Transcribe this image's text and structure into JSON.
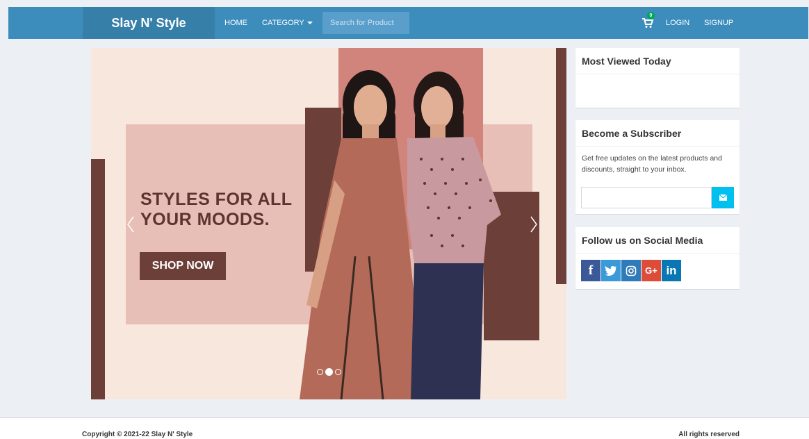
{
  "navbar": {
    "brand": "Slay N' Style",
    "home": "HOME",
    "category": "CATEGORY",
    "search_placeholder": "Search for Product",
    "cart_count": "0",
    "login": "LOGIN",
    "signup": "SIGNUP",
    "bg_color": "#3c8dbc"
  },
  "carousel": {
    "headline_line1": "STYLES FOR ALL",
    "headline_line2": "YOUR MOODS.",
    "cta": "SHOP NOW",
    "slide_count": 3,
    "active_slide": 2
  },
  "sidebar": {
    "most_viewed_title": "Most Viewed Today",
    "subscriber_title": "Become a Subscriber",
    "subscriber_text": "Get free updates on the latest products and discounts, straight to your inbox.",
    "subscribe_icon": "envelope-icon",
    "social_title": "Follow us on Social Media",
    "social": [
      {
        "icon": "facebook-icon",
        "glyph": "f"
      },
      {
        "icon": "twitter-icon",
        "glyph": ""
      },
      {
        "icon": "instagram-icon",
        "glyph": ""
      },
      {
        "icon": "google-plus-icon",
        "glyph": "G+"
      },
      {
        "icon": "linkedin-icon",
        "glyph": "in"
      }
    ]
  },
  "footer": {
    "copyright": "Copyright © 2021-22 Slay N' Style",
    "rights": "All rights reserved"
  }
}
